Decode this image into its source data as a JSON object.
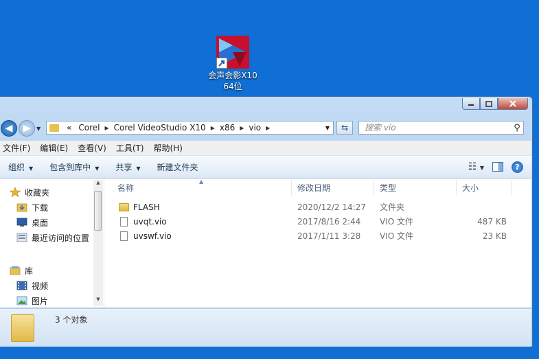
{
  "desktop": {
    "icon_label_line1": "会声会影X10",
    "icon_label_line2": "64位"
  },
  "window": {
    "caption_buttons": [
      "minimize",
      "maximize",
      "close"
    ]
  },
  "nav": {
    "breadcrumb_prefix": "«",
    "breadcrumbs": [
      "Corel",
      "Corel VideoStudio X10",
      "x86",
      "vio"
    ],
    "search_placeholder": "搜索 vio"
  },
  "menu": [
    "文件(F)",
    "编辑(E)",
    "查看(V)",
    "工具(T)",
    "帮助(H)"
  ],
  "toolbar": {
    "organize": "组织",
    "include_library": "包含到库中",
    "share": "共享",
    "new_folder": "新建文件夹"
  },
  "sidebar": {
    "favorites_header": "收藏夹",
    "favorites": [
      "下载",
      "桌面",
      "最近访问的位置"
    ],
    "libraries_header": "库",
    "libraries": [
      "视频",
      "图片"
    ]
  },
  "columns": {
    "name": "名称",
    "modified": "修改日期",
    "type": "类型",
    "size": "大小"
  },
  "files": [
    {
      "name": "FLASH",
      "modified": "2020/12/2 14:27",
      "type": "文件夹",
      "size": "",
      "icon": "folder-icon"
    },
    {
      "name": "uvqt.vio",
      "modified": "2017/8/16 2:44",
      "type": "VIO 文件",
      "size": "487 KB",
      "icon": "file-icon"
    },
    {
      "name": "uvswf.vio",
      "modified": "2017/1/11 3:28",
      "type": "VIO 文件",
      "size": "23 KB",
      "icon": "file-icon"
    }
  ],
  "details": {
    "count": "3 个对象"
  },
  "colors": {
    "desktop": "#0f6fd4",
    "window_frame": "#c3dcf5",
    "folder": "#e7c24f"
  }
}
